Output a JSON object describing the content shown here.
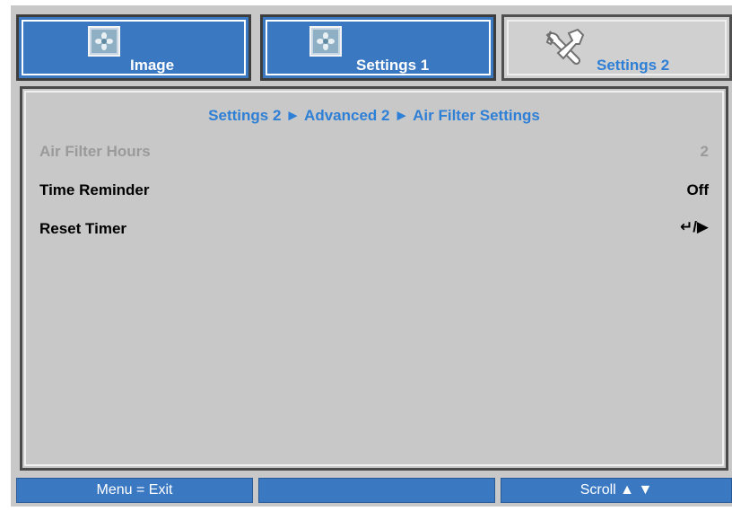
{
  "tabs": [
    {
      "label": "Image",
      "icon": "image-icon",
      "state": "inactive"
    },
    {
      "label": "Settings 1",
      "icon": "image-icon",
      "state": "inactive"
    },
    {
      "label": "Settings 2",
      "icon": "tools-icon",
      "state": "active"
    }
  ],
  "breadcrumb": "Settings 2 ► Advanced 2 ► Air Filter Settings",
  "rows": [
    {
      "label": "Air Filter Hours",
      "value": "2",
      "enabled": false
    },
    {
      "label": "Time Reminder",
      "value": "Off",
      "enabled": true
    },
    {
      "label": "Reset Timer",
      "value": "↵/▶",
      "enabled": true
    }
  ],
  "statusbar": {
    "left": "Menu = Exit",
    "middle": "",
    "right": "Scroll ▲ ▼"
  },
  "colors": {
    "accent_blue": "#3a78c2",
    "text_blue": "#2e7fd6",
    "panel_gray": "#c8c8c8",
    "disabled_gray": "#9a9a9a"
  }
}
